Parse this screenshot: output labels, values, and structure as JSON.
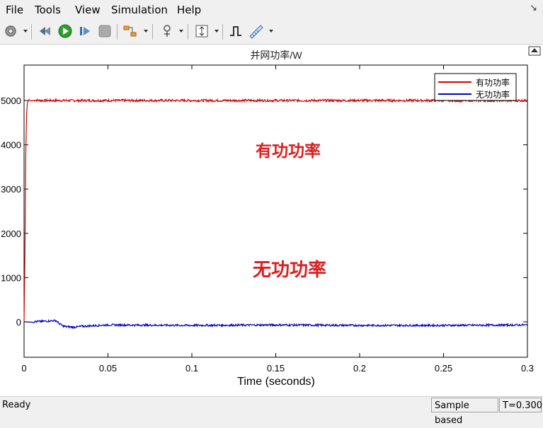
{
  "menu": [
    "File",
    "Tools",
    "View",
    "Simulation",
    "Help"
  ],
  "toolbar_icons": [
    "settings-icon",
    "rewind-icon",
    "run-icon",
    "step-forward-icon",
    "stop-icon",
    "highlight-model-icon",
    "zoom-icon",
    "autoscale-icon",
    "signal-trigger-icon",
    "measurements-icon"
  ],
  "status": {
    "ready": "Ready",
    "mode": "Sample based",
    "time": "T=0.300"
  },
  "annotations": {
    "active": "有功功率",
    "reactive": "无功功率"
  },
  "colors": {
    "active": "#d40000",
    "reactive": "#0000c8",
    "annotation": "#dc1e1e"
  },
  "chart_data": {
    "type": "line",
    "title": "并网功率/W",
    "xlabel": "Time (seconds)",
    "ylabel": "",
    "xlim": [
      0,
      0.3
    ],
    "ylim": [
      -800,
      5800
    ],
    "xticks": [
      0,
      0.05,
      0.1,
      0.15,
      0.2,
      0.25,
      0.3
    ],
    "xtick_labels": [
      "0",
      "0.05",
      "0.1",
      "0.15",
      "0.2",
      "0.25",
      "0.3"
    ],
    "yticks": [
      0,
      1000,
      2000,
      3000,
      4000,
      5000
    ],
    "ytick_labels": [
      "0",
      "1000",
      "2000",
      "3000",
      "4000",
      "5000"
    ],
    "legend_position": "top-right",
    "grid": false,
    "series": [
      {
        "name": "有功功率",
        "color": "#d40000",
        "x": [
          0,
          0.0005,
          0.001,
          0.0015,
          0.002,
          0.003,
          0.004,
          0.006,
          0.01,
          0.02,
          0.05,
          0.1,
          0.15,
          0.2,
          0.25,
          0.3
        ],
        "y": [
          0,
          1500,
          3800,
          4700,
          4950,
          5020,
          4990,
          5010,
          5000,
          5000,
          5000,
          5000,
          5000,
          5000,
          5000,
          5000
        ]
      },
      {
        "name": "无功功率",
        "color": "#0000c8",
        "x": [
          0,
          0.005,
          0.01,
          0.015,
          0.019,
          0.021,
          0.023,
          0.025,
          0.03,
          0.035,
          0.04,
          0.05,
          0.1,
          0.15,
          0.2,
          0.25,
          0.3
        ],
        "y": [
          0,
          0,
          10,
          20,
          30,
          -40,
          -90,
          -110,
          -120,
          -100,
          -90,
          -70,
          -80,
          -70,
          -80,
          -80,
          -70
        ]
      }
    ]
  }
}
